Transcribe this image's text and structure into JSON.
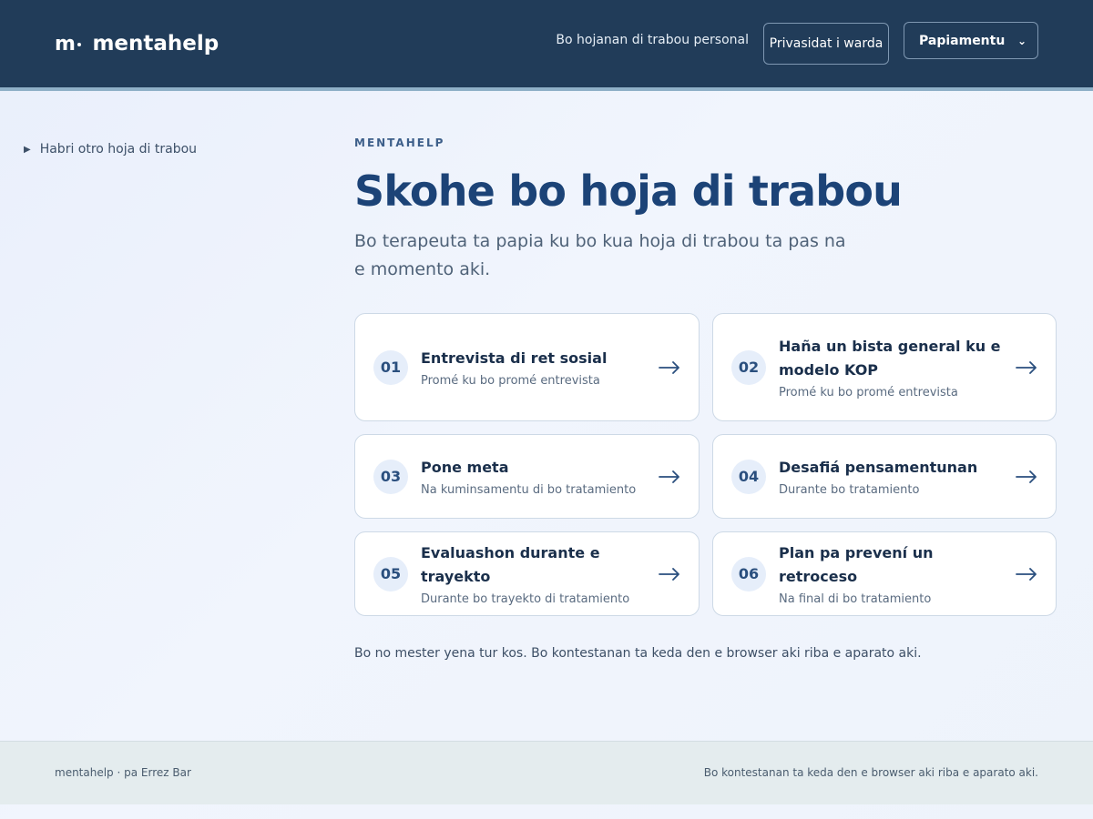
{
  "header": {
    "brand_mark": "m",
    "brand_name": "mentahelp",
    "nav_link": "Bo hojanan di trabou personal",
    "privacy_button": "Privasidat i warda",
    "language": {
      "selected": "Papiamentu"
    }
  },
  "sidebar": {
    "toggle_label": "Habri otro hoja di trabou"
  },
  "main": {
    "eyebrow": "MENTAHELP",
    "title": "Skohe bo hoja di trabou",
    "subtitle": "Bo terapeuta ta papia ku bo kua hoja di trabou ta pas na e momento aki.",
    "cards": [
      {
        "num": "01",
        "title": "Entrevista di ret sosial",
        "sub": "Promé ku bo promé entrevista"
      },
      {
        "num": "02",
        "title": "Haña un bista general ku e modelo KOP",
        "sub": "Promé ku bo promé entrevista"
      },
      {
        "num": "03",
        "title": "Pone meta",
        "sub": "Na kuminsamentu di bo tratamiento"
      },
      {
        "num": "04",
        "title": "Desafiá pensamentunan",
        "sub": "Durante bo tratamiento"
      },
      {
        "num": "05",
        "title": "Evaluashon durante e trayekto",
        "sub": "Durante bo trayekto di tratamiento"
      },
      {
        "num": "06",
        "title": "Plan pa prevení un retroceso",
        "sub": "Na final di bo tratamiento"
      }
    ],
    "note": "Bo no mester yena tur kos. Bo kontestanan ta keda den e browser aki riba e aparato aki."
  },
  "footer": {
    "left": "mentahelp · pa Errez Bar",
    "right": "Bo kontestanan ta keda den e browser aki riba e aparato aki."
  },
  "colors": {
    "header_bg": "#213c59",
    "accent": "#1c4377",
    "footer_bg": "#e4ecee"
  }
}
